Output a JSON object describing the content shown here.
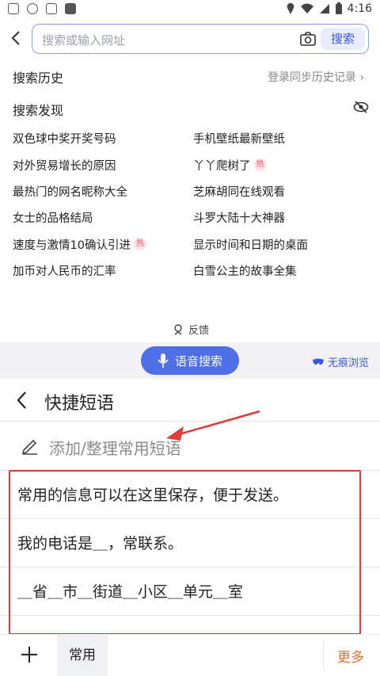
{
  "status_bar": {
    "time": "4:16"
  },
  "browser": {
    "search_placeholder": "搜索或输入网址",
    "search_button": "搜索"
  },
  "history": {
    "title": "搜索历史",
    "sync_link": "登录同步历史记录 ›"
  },
  "discover": {
    "title": "搜索发现",
    "hot_badge": "热",
    "items": [
      {
        "text": "双色球中奖开奖号码",
        "hot": false
      },
      {
        "text": "手机壁纸最新壁纸",
        "hot": false
      },
      {
        "text": "对外贸易增长的原因",
        "hot": false
      },
      {
        "text": "丫丫爬树了",
        "hot": true
      },
      {
        "text": "最热门的网名昵称大全",
        "hot": false
      },
      {
        "text": "芝麻胡同在线观看",
        "hot": false
      },
      {
        "text": "女士的品格结局",
        "hot": false
      },
      {
        "text": "斗罗大陆十大神器",
        "hot": false
      },
      {
        "text": "速度与激情10确认引进",
        "hot": true
      },
      {
        "text": "显示时间和日期的桌面",
        "hot": false
      },
      {
        "text": "加币对人民币的汇率",
        "hot": false
      },
      {
        "text": "白雪公主的故事全集",
        "hot": false
      }
    ]
  },
  "feedback_label": "反馈",
  "voice_search_label": "语音搜索",
  "incognito_label": "无痕浏览",
  "quick_phrases": {
    "title": "快捷短语",
    "add_label": "添加/整理常用短语",
    "phrases": [
      "常用的信息可以在这里保存，便于发送。",
      "我的电话是＿，常联系。",
      "＿省＿市＿街道＿小区＿单元＿室",
      "…"
    ]
  },
  "bottom_bar": {
    "plus": "+",
    "tab_common": "常用",
    "more": "更多"
  },
  "colors": {
    "accent": "#4f6fe8",
    "highlight": "#e23a3a",
    "more": "#f06a2a"
  }
}
